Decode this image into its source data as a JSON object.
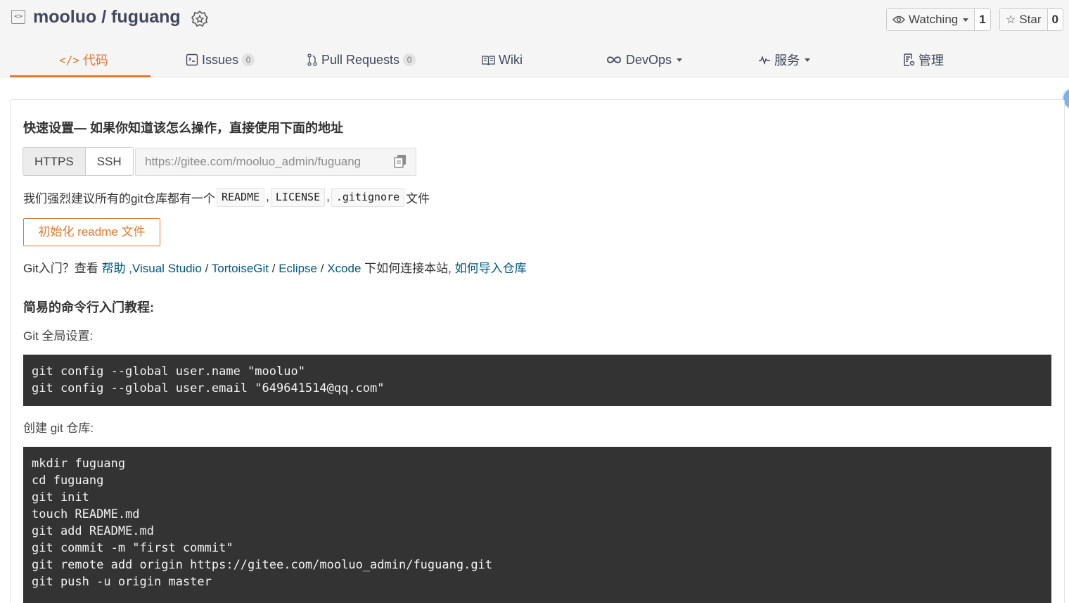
{
  "header": {
    "owner": "mooluo",
    "separator": " / ",
    "repo": "fuguang",
    "watch": {
      "label": "Watching",
      "count": "1"
    },
    "star": {
      "label": "Star",
      "count": "0"
    }
  },
  "tabs": [
    {
      "label": "代码",
      "icon": "code-icon"
    },
    {
      "label": "Issues",
      "badge": "0",
      "icon": "issues-icon"
    },
    {
      "label": "Pull Requests",
      "badge": "0",
      "icon": "pull-request-icon"
    },
    {
      "label": "Wiki",
      "icon": "wiki-icon"
    },
    {
      "label": "DevOps",
      "icon": "infinity-icon"
    },
    {
      "label": "服务",
      "icon": "pulse-icon"
    },
    {
      "label": "管理",
      "icon": "settings-doc-icon"
    }
  ],
  "quick_setup": {
    "title": "快速设置— 如果你知道该怎么操作，直接使用下面的地址",
    "protocols": [
      "HTTPS",
      "SSH"
    ],
    "url": "https://gitee.com/mooluo_admin/fuguang",
    "recommend_prefix": "我们强烈建议所有的git仓库都有一个",
    "files": [
      "README",
      "LICENSE",
      ".gitignore"
    ],
    "recommend_sep": ",",
    "recommend_suffix": "文件",
    "init_button": "初始化 readme 文件",
    "help_prefix": "Git入门？查看",
    "help_link": "帮助",
    "help_sep1": ",",
    "vs_link": "Visual Studio",
    "slash": "/",
    "tortoise_link": "TortoiseGit",
    "eclipse_link": "Eclipse",
    "xcode_link": "Xcode",
    "help_mid": "下如何连接本站,",
    "import_link": "如何导入仓库"
  },
  "tutorial": {
    "title": "简易的命令行入门教程:",
    "global_label": "Git 全局设置:",
    "global_code": "git config --global user.name \"mooluo\"\ngit config --global user.email \"649641514@qq.com\"",
    "create_label": "创建 git 仓库:",
    "create_code": "mkdir fuguang\ncd fuguang\ngit init\ntouch README.md\ngit add README.md\ngit commit -m \"first commit\"\ngit remote add origin https://gitee.com/mooluo_admin/fuguang.git\ngit push -u origin master"
  },
  "colors": {
    "accent": "#e3782b",
    "link": "#005980",
    "code_bg": "#333333"
  }
}
